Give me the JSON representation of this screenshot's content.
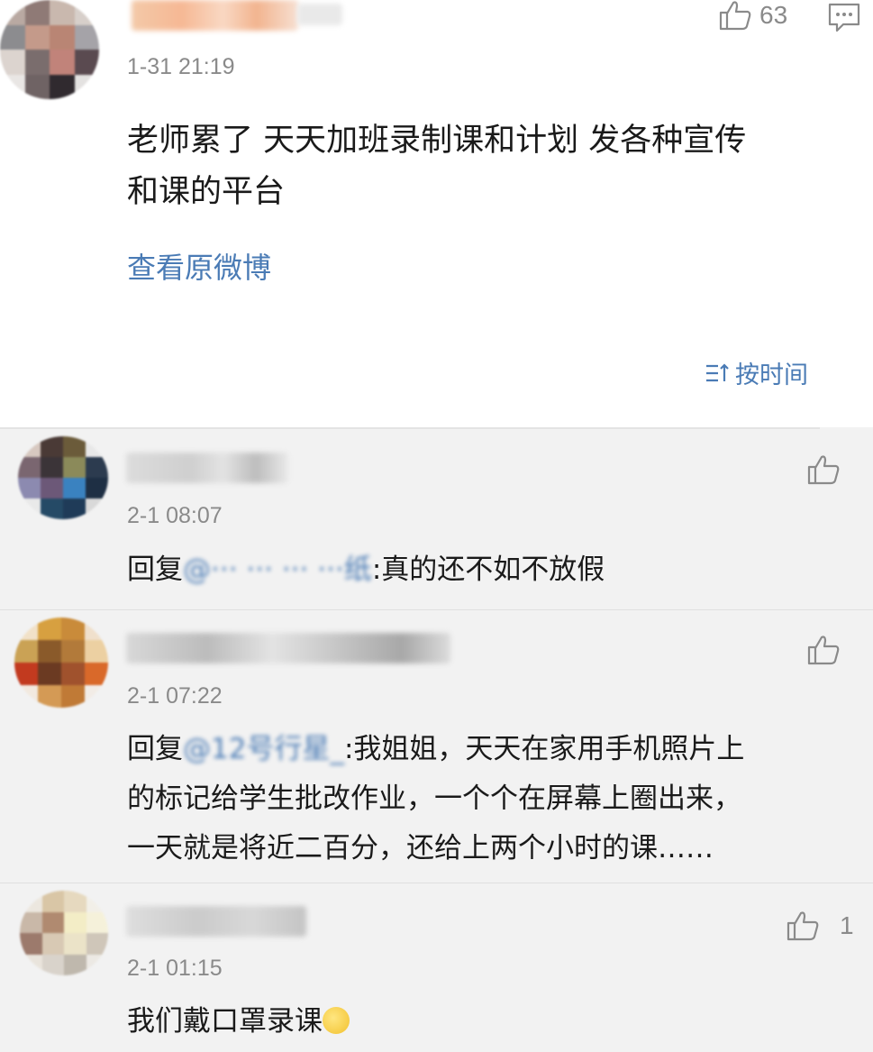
{
  "post": {
    "time": "1-31 21:19",
    "likes": "63",
    "text_line1": "老师累了 天天加班录制课和计划 发各种宣传",
    "text_line2": "和课的平台",
    "view_original": "查看原微博"
  },
  "sort": {
    "label": "按时间"
  },
  "comments": [
    {
      "time": "2-1 08:07",
      "reply_prefix": "回复",
      "mention": "@··· ··· ··· ···纸",
      "reply_text": ":真的还不如不放假",
      "likes": ""
    },
    {
      "time": "2-1 07:22",
      "reply_prefix": "回复",
      "mention": "@12号行星_",
      "reply_text_line1": ":我姐姐，天天在家用手机照片上",
      "reply_text_line2": "的标记给学生批改作业，一个个在屏幕上圈出来，",
      "reply_text_line3": "一天就是将近二百分，还给上两个小时的课……",
      "likes": ""
    },
    {
      "time": "2-1 01:15",
      "text": "我们戴口罩录课",
      "likes": "1"
    }
  ],
  "icons": {
    "like": "thumbs-up-icon",
    "comment": "comment-icon",
    "sort": "sort-icon",
    "emoji": "face-emoji-icon"
  },
  "colors": {
    "link": "#4a7bb5",
    "muted": "#8a8a8a",
    "comment_bg": "#f2f2f2"
  }
}
